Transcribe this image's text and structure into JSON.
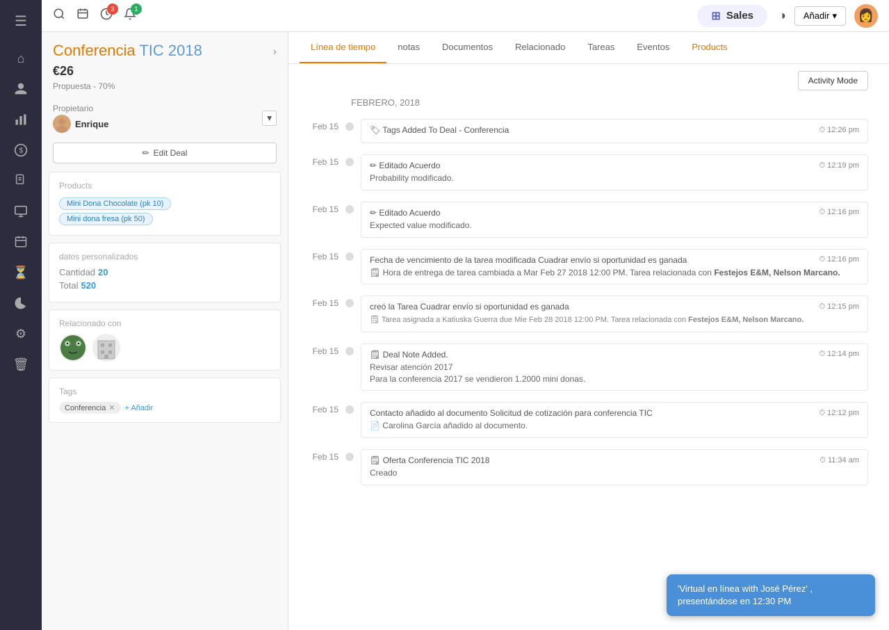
{
  "sidebar": {
    "icons": [
      {
        "name": "menu-icon",
        "symbol": "☰",
        "interactable": true
      },
      {
        "name": "home-icon",
        "symbol": "⌂",
        "interactable": true
      },
      {
        "name": "contacts-icon",
        "symbol": "👤",
        "interactable": true
      },
      {
        "name": "reports-icon",
        "symbol": "📊",
        "interactable": true
      },
      {
        "name": "money-icon",
        "symbol": "💲",
        "interactable": true
      },
      {
        "name": "documents-icon",
        "symbol": "📄",
        "interactable": true
      },
      {
        "name": "screen-icon",
        "symbol": "🖥",
        "interactable": true
      },
      {
        "name": "calendar-icon",
        "symbol": "📅",
        "interactable": true
      },
      {
        "name": "hourglass-icon",
        "symbol": "⏳",
        "interactable": true
      },
      {
        "name": "chart-icon",
        "symbol": "📈",
        "interactable": true
      },
      {
        "name": "settings-icon",
        "symbol": "⚙",
        "interactable": true
      },
      {
        "name": "trash-icon",
        "symbol": "🗑",
        "interactable": true
      }
    ]
  },
  "topbar": {
    "search_icon": "🔍",
    "calendar_icon": "📅",
    "activity_badge": "3",
    "updates_badge": "1",
    "app_name": "Sales",
    "anadir_label": "Añadir",
    "half_circle": "◑"
  },
  "deal": {
    "title_part1": "Conferencia ",
    "title_part2": "TIC 2018",
    "price": "€26",
    "stage": "Propuesta - 70%",
    "propietario_label": "Propietario",
    "owner_name": "Enrique",
    "edit_deal_label": "Edit Deal"
  },
  "products_section": {
    "title": "Products",
    "items": [
      {
        "label": "Mini Dona Chocolate (pk 10)"
      },
      {
        "label": "Mini dona fresa (pk 50)"
      }
    ]
  },
  "custom_data": {
    "title": "datos personalizados",
    "cantidad_label": "Cantidad",
    "cantidad_value": "20",
    "total_label": "Total",
    "total_value": "520"
  },
  "relacionado": {
    "title": "Relacionado con"
  },
  "tags_section": {
    "title": "Tags",
    "items": [
      {
        "label": "Conferencia"
      }
    ],
    "add_label": "+ Añadir"
  },
  "tabs": [
    {
      "label": "Línea de tiempo",
      "active": true
    },
    {
      "label": "notas"
    },
    {
      "label": "Documentos"
    },
    {
      "label": "Relacionado"
    },
    {
      "label": "Tareas"
    },
    {
      "label": "Eventos"
    },
    {
      "label": "Products",
      "highlight": true
    }
  ],
  "activity_mode": {
    "button_label": "Activity Mode"
  },
  "timeline": {
    "month_label": "FEBRERO, 2018",
    "entries": [
      {
        "date": "Feb 15",
        "icon": "🏷",
        "title": "Tags Added To Deal - Conferencia",
        "time": "12:26 pm"
      },
      {
        "date": "Feb 15",
        "icon": "✏",
        "title": "Editado Acuerdo",
        "time": "12:19 pm",
        "body": "Probability modificado."
      },
      {
        "date": "Feb 15",
        "icon": "✏",
        "title": "Editado Acuerdo",
        "time": "12:16 pm",
        "body": "Expected value modificado."
      },
      {
        "date": "Feb 15",
        "icon": "",
        "title": "Fecha de vencimiento de la tarea modificada Cuadrar envío si oportunidad es ganada",
        "time": "12:16 pm",
        "body": "🗒 Hora de entrega de tarea cambiada a Mar Feb 27 2018 12:00 PM. Tarea relacionada con Festejos E&M, Nelson Marcano."
      },
      {
        "date": "Feb 15",
        "icon": "",
        "title": "creó la Tarea Cuadrar envío si oportunidad es ganada",
        "time": "12:15 pm",
        "body_small": "🗒 Tarea asignada a Katiuska Guerra due Mie Feb 28 2018 12:00 PM. Tarea relacionada con Festejos E&M, Nelson Marcano."
      },
      {
        "date": "Feb 15",
        "icon": "🗒",
        "title": "Deal Note Added.",
        "time": "12:14 pm",
        "body": "Revisar atención 2017\nPara la conferencia 2017 se vendieron 1.2000 mini donas."
      },
      {
        "date": "Feb 15",
        "icon": "",
        "title": "Contacto añadido al documento Solicitud de cotización para conferencia TIC",
        "time": "12:12 pm",
        "body": "📄 Carolina García añadido al documento."
      },
      {
        "date": "Feb 15",
        "icon": "🗒",
        "title": "Oferta Conferencia TIC 2018",
        "time": "11:34 am",
        "body": "Creado"
      }
    ]
  },
  "chat_bubble": {
    "text": "'Virtual en línea with José Pérez' , presentándose en 12:30 PM"
  }
}
